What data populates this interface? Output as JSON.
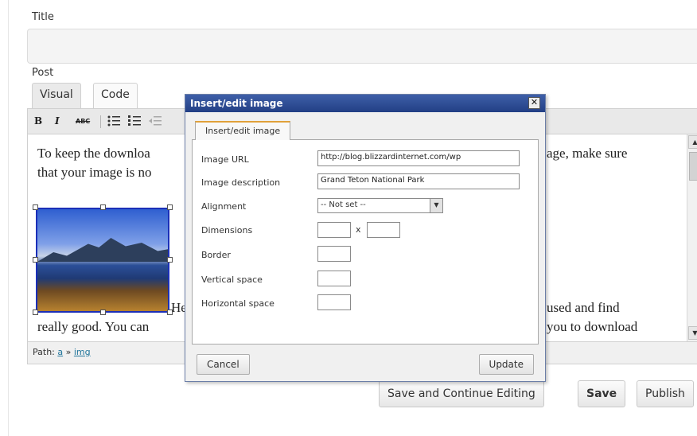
{
  "form": {
    "title_label": "Title",
    "post_label": "Post",
    "tabs": [
      {
        "label": "Visual"
      },
      {
        "label": "Code"
      }
    ]
  },
  "toolbar": {
    "bold": "B",
    "italic": "I",
    "strike": "ABC",
    "icons": [
      "bold-icon",
      "italic-icon",
      "strikethrough-icon",
      "bullet-list-icon",
      "numbered-list-icon",
      "outdent-icon"
    ]
  },
  "editor": {
    "lines": [
      "To keep the downloa",
      "that your image is no",
      "He",
      "really good.  You can",
      "age, make sure",
      "used and find",
      "you to download"
    ]
  },
  "path": {
    "label": "Path:",
    "crumb_a": "a",
    "sep": "»",
    "crumb_img": "img"
  },
  "actions": {
    "save_continue": "Save and Continue Editing",
    "save": "Save",
    "publish": "Publish"
  },
  "dialog": {
    "title": "Insert/edit image",
    "close": "✕",
    "tab": "Insert/edit image",
    "fields": {
      "image_url": {
        "label": "Image URL",
        "value": "http://blog.blizzardinternet.com/wp"
      },
      "description": {
        "label": "Image description",
        "value": "Grand Teton National Park"
      },
      "alignment": {
        "label": "Alignment",
        "value": "-- Not set --"
      },
      "dimensions": {
        "label": "Dimensions",
        "times": "x"
      },
      "border": {
        "label": "Border"
      },
      "vspace": {
        "label": "Vertical space"
      },
      "hspace": {
        "label": "Horizontal space"
      }
    },
    "cancel": "Cancel",
    "update": "Update"
  }
}
